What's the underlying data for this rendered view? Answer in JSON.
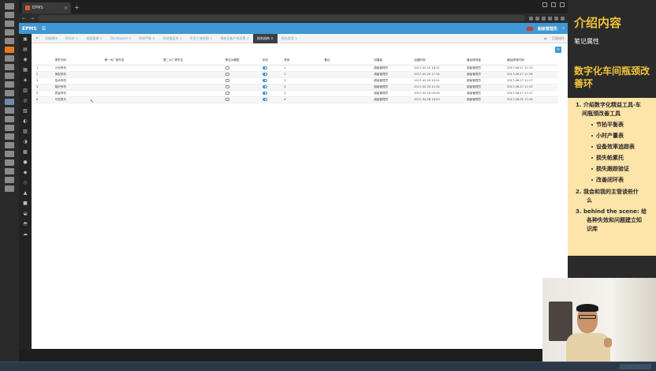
{
  "browser": {
    "tab_title": "EPMS",
    "tab_close": "×",
    "new_tab": "+"
  },
  "app": {
    "brand": "EPMS",
    "user": "超级管理员",
    "tabs": [
      {
        "label": "功能模块",
        "active": false
      },
      {
        "label": "IE优化 ×",
        "active": false
      },
      {
        "label": "班组管理 ×",
        "active": false
      },
      {
        "label": "Dashboard ×",
        "active": false
      },
      {
        "label": "IE线平衡 ×",
        "active": false
      },
      {
        "label": "IE设备监控 ×",
        "active": false
      },
      {
        "label": "IE员工流程图 ×",
        "active": false
      },
      {
        "label": "增加设备产线设置 ×",
        "active": false
      },
      {
        "label": "损失结构 ×",
        "active": true
      },
      {
        "label": "损失类型 ×",
        "active": false
      }
    ],
    "tabbar_right": [
      "▸▸",
      "页面操作"
    ],
    "refresh_icon": "↻"
  },
  "table": {
    "headers": [
      "",
      "损失代码",
      "第一大厂损失名",
      "第二大厂损失名",
      "是否为模型",
      "状态",
      "排序",
      "备注",
      "创建者",
      "创建时间",
      "最后修改者",
      "最后修改时间"
    ],
    "rows": [
      {
        "index": "1",
        "name": "计划停机",
        "sort": "1",
        "creator": "超级管理员",
        "created": "2017-02-10 18:31",
        "modifier": "超级管理员",
        "modified": "2017-08-27 11:13"
      },
      {
        "index": "2",
        "name": "换型停机",
        "sort": "2",
        "creator": "超级管理员",
        "created": "2017-02-20 17:24",
        "modifier": "超级管理员",
        "modified": "2017-08-27 11:16"
      },
      {
        "index": "3",
        "name": "技术停机",
        "sort": "3",
        "creator": "超级管理员",
        "created": "2017-02-20 10:21",
        "modifier": "超级管理员",
        "modified": "2017-08-27 11:17"
      },
      {
        "index": "4",
        "name": "组织停机",
        "sort": "4",
        "creator": "超级管理员",
        "created": "2017-02-20 11:25",
        "modifier": "超级管理员",
        "modified": "2017-08-27 11:15"
      },
      {
        "index": "5",
        "name": "质量停机",
        "sort": "5",
        "creator": "超级管理员",
        "created": "2017-02-20 09:43",
        "modifier": "超级管理员",
        "modified": "2017-08-27 11:17"
      },
      {
        "index": "6",
        "name": "可变损失",
        "sort": "6",
        "creator": "超级管理员",
        "created": "2017-04-28 16:23",
        "modifier": "超级管理员",
        "modified": "2017-08-02 11:18"
      }
    ]
  },
  "notes": {
    "title": "介绍内容",
    "subtitle": "笔记属性",
    "heading": "数字化车间瓶颈改善环",
    "item1_line1": "1. 介绍数字化精益工具-车",
    "item1_line2": "间瓶颈改善工具",
    "bullets": [
      "节拍平衡表",
      "小时产量表",
      "设备效率追踪表",
      "损失帕累托",
      "损失跟踪验证",
      "改善闭环表"
    ],
    "item2_line1": "2. 我会和我的主管谈些什",
    "item2_line2": "么",
    "item3_line1": "3. behind the scene: 给",
    "item3_line2": "各种失效和问题建立知",
    "item3_line3": "识库"
  }
}
